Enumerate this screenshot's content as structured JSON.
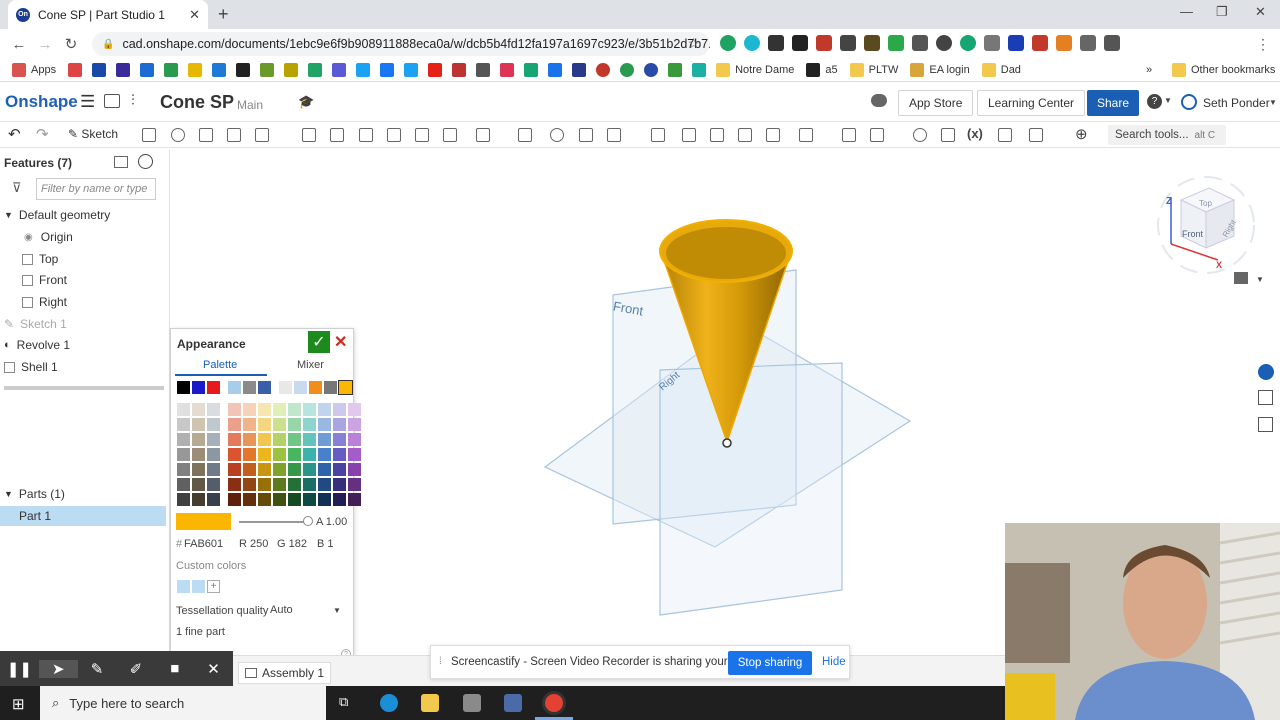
{
  "browser": {
    "tab_title": "Cone SP | Part Studio 1",
    "url": "cad.onshape.com/documents/1ebc9e6f9b908911888eca0a/w/dcb5b4fd12fa197a1697c923/e/3b51b2d7b7...",
    "bookmarks": [
      "Apps",
      "Notre Dame",
      "a5",
      "PLTW",
      "EA login",
      "Dad",
      "Other bookmarks"
    ]
  },
  "onshape": {
    "logo": "Onshape",
    "doc_name": "Cone SP",
    "branch": "Main",
    "app_store": "App Store",
    "learning_center": "Learning Center",
    "share": "Share",
    "user": "Seth Ponder",
    "sketch": "Sketch",
    "search_tools": "Search tools...",
    "search_shortcut": "alt C"
  },
  "tree": {
    "header": "Features (7)",
    "filter_placeholder": "Filter by name or type",
    "default_geometry": "Default geometry",
    "items": [
      "Origin",
      "Top",
      "Front",
      "Right",
      "Sketch 1",
      "Revolve 1",
      "Shell 1"
    ],
    "parts_header": "Parts (1)",
    "part": "Part 1"
  },
  "appearance": {
    "title": "Appearance",
    "tab_palette": "Palette",
    "tab_mixer": "Mixer",
    "alpha": "A 1.00",
    "hex_label": "#",
    "hex": "FAB601",
    "r": "R 250",
    "g": "G 182",
    "b": "B 1",
    "custom_colors": "Custom colors",
    "tess_label": "Tessellation quality",
    "tess_value": "Auto",
    "fine_part": "1 fine part",
    "selected_color": "#fab601"
  },
  "viewport": {
    "plane_front": "Front",
    "plane_right": "Right",
    "cube_top": "Top",
    "cube_front": "Front",
    "cube_right": "Right",
    "axis_z": "Z",
    "axis_x": "X"
  },
  "bottom": {
    "assembly_tab": "Assembly 1",
    "notice": "Screencastify - Screen Video Recorder is sharing your screen.",
    "stop": "Stop sharing",
    "hide": "Hide",
    "taskbar_search": "Type here to search"
  }
}
